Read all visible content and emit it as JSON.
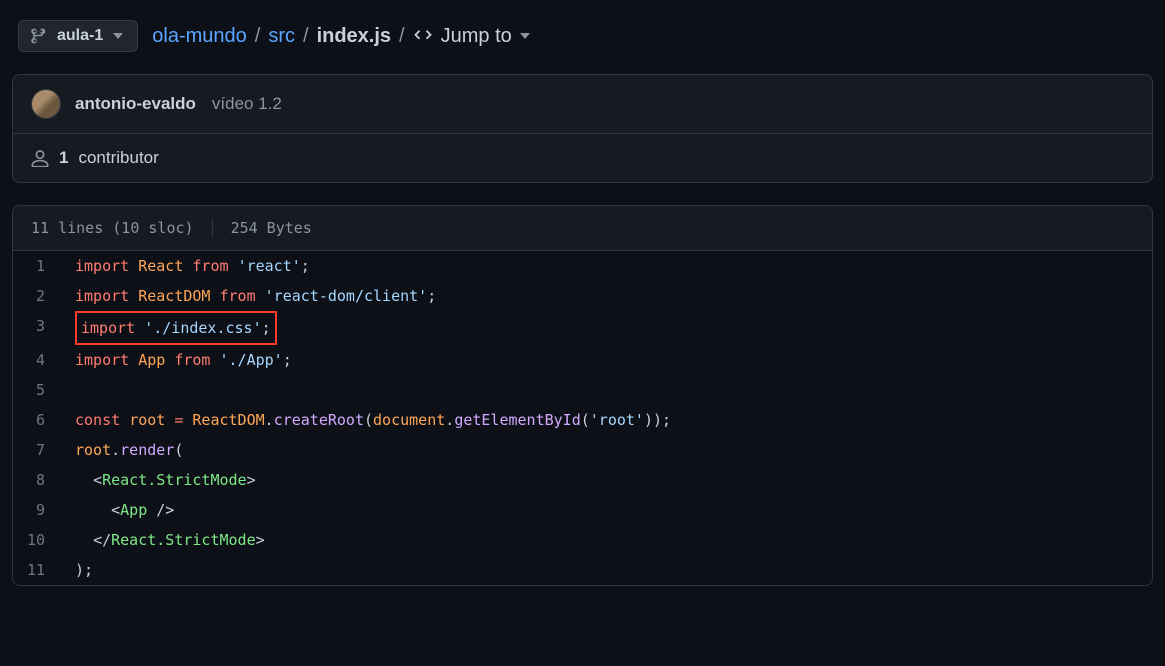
{
  "branch": "aula-1",
  "breadcrumb": {
    "repo": "ola-mundo",
    "folder": "src",
    "file": "index.js",
    "jump_to": "Jump to"
  },
  "commit": {
    "author": "antonio-evaldo",
    "message": "vídeo 1.2"
  },
  "contributors": {
    "count": "1",
    "label": "contributor"
  },
  "file_stats": {
    "lines_sloc": "11 lines (10 sloc)",
    "bytes": "254 Bytes"
  },
  "code_lines": [
    {
      "n": "1",
      "tokens": [
        [
          "kw",
          "import"
        ],
        [
          "plain",
          " "
        ],
        [
          "var",
          "React"
        ],
        [
          "plain",
          " "
        ],
        [
          "kw",
          "from"
        ],
        [
          "plain",
          " "
        ],
        [
          "str",
          "'react'"
        ],
        [
          "plain",
          ";"
        ]
      ]
    },
    {
      "n": "2",
      "tokens": [
        [
          "kw",
          "import"
        ],
        [
          "plain",
          " "
        ],
        [
          "var",
          "ReactDOM"
        ],
        [
          "plain",
          " "
        ],
        [
          "kw",
          "from"
        ],
        [
          "plain",
          " "
        ],
        [
          "str",
          "'react-dom/client'"
        ],
        [
          "plain",
          ";"
        ]
      ]
    },
    {
      "n": "3",
      "highlight": true,
      "tokens": [
        [
          "kw",
          "import"
        ],
        [
          "plain",
          " "
        ],
        [
          "str",
          "'./index.css'"
        ],
        [
          "plain",
          ";"
        ]
      ]
    },
    {
      "n": "4",
      "tokens": [
        [
          "kw",
          "import"
        ],
        [
          "plain",
          " "
        ],
        [
          "var",
          "App"
        ],
        [
          "plain",
          " "
        ],
        [
          "kw",
          "from"
        ],
        [
          "plain",
          " "
        ],
        [
          "str",
          "'./App'"
        ],
        [
          "plain",
          ";"
        ]
      ]
    },
    {
      "n": "5",
      "tokens": []
    },
    {
      "n": "6",
      "tokens": [
        [
          "kw",
          "const"
        ],
        [
          "plain",
          " "
        ],
        [
          "var",
          "root"
        ],
        [
          "plain",
          " "
        ],
        [
          "kw",
          "="
        ],
        [
          "plain",
          " "
        ],
        [
          "var",
          "ReactDOM"
        ],
        [
          "plain",
          "."
        ],
        [
          "func",
          "createRoot"
        ],
        [
          "plain",
          "("
        ],
        [
          "var",
          "document"
        ],
        [
          "plain",
          "."
        ],
        [
          "func",
          "getElementById"
        ],
        [
          "plain",
          "("
        ],
        [
          "str",
          "'root'"
        ],
        [
          "plain",
          "));"
        ]
      ]
    },
    {
      "n": "7",
      "tokens": [
        [
          "var",
          "root"
        ],
        [
          "plain",
          "."
        ],
        [
          "func",
          "render"
        ],
        [
          "plain",
          "("
        ]
      ]
    },
    {
      "n": "8",
      "tokens": [
        [
          "plain",
          "  "
        ],
        [
          "plain",
          "<"
        ],
        [
          "tag",
          "React.StrictMode"
        ],
        [
          "plain",
          ">"
        ]
      ]
    },
    {
      "n": "9",
      "tokens": [
        [
          "plain",
          "    "
        ],
        [
          "plain",
          "<"
        ],
        [
          "tag",
          "App"
        ],
        [
          "plain",
          " />"
        ]
      ]
    },
    {
      "n": "10",
      "tokens": [
        [
          "plain",
          "  "
        ],
        [
          "plain",
          "</"
        ],
        [
          "tag",
          "React.StrictMode"
        ],
        [
          "plain",
          ">"
        ]
      ]
    },
    {
      "n": "11",
      "tokens": [
        [
          "plain",
          ");"
        ]
      ]
    }
  ]
}
